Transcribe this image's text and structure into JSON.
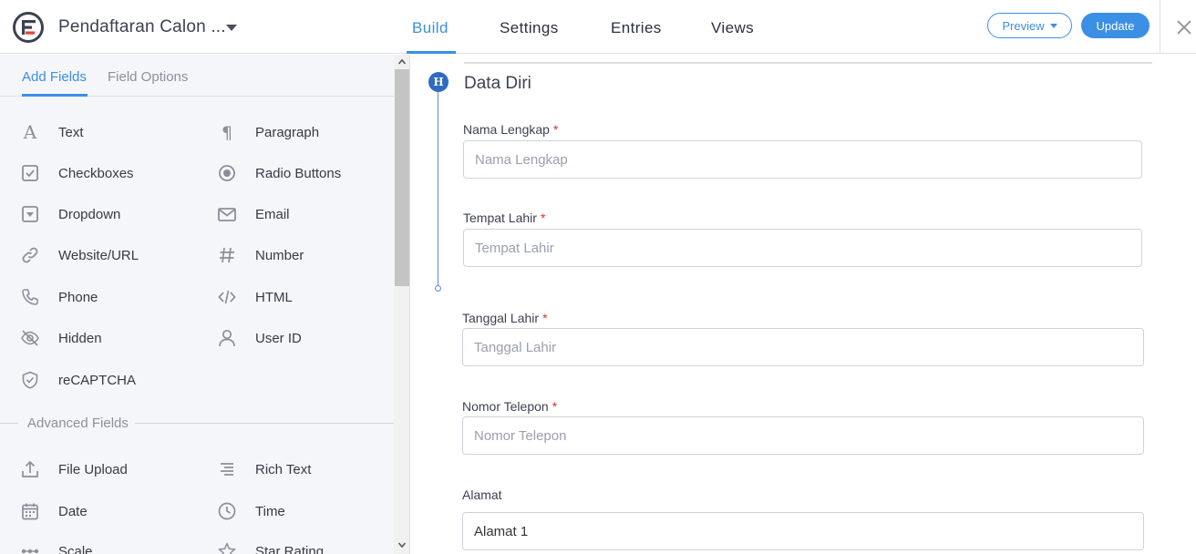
{
  "header": {
    "form_title": "Pendaftaran Calon ...",
    "nav_tabs": [
      "Build",
      "Settings",
      "Entries",
      "Views"
    ],
    "active_tab": "Build",
    "preview_label": "Preview",
    "update_label": "Update",
    "accent_color": "#3b8fe4"
  },
  "sidebar": {
    "tabs": [
      "Add Fields",
      "Field Options"
    ],
    "active_tab": "Add Fields",
    "fields": [
      {
        "label": "Text",
        "icon": "text-icon"
      },
      {
        "label": "Paragraph",
        "icon": "paragraph-icon"
      },
      {
        "label": "Checkboxes",
        "icon": "checkbox-icon"
      },
      {
        "label": "Radio Buttons",
        "icon": "radio-icon"
      },
      {
        "label": "Dropdown",
        "icon": "dropdown-icon"
      },
      {
        "label": "Email",
        "icon": "email-icon"
      },
      {
        "label": "Website/URL",
        "icon": "link-icon"
      },
      {
        "label": "Number",
        "icon": "hash-icon"
      },
      {
        "label": "Phone",
        "icon": "phone-icon"
      },
      {
        "label": "HTML",
        "icon": "code-icon"
      },
      {
        "label": "Hidden",
        "icon": "eye-off-icon"
      },
      {
        "label": "User ID",
        "icon": "user-icon"
      },
      {
        "label": "reCAPTCHA",
        "icon": "shield-icon"
      }
    ],
    "advanced_label": "Advanced Fields",
    "advanced_fields": [
      {
        "label": "File Upload",
        "icon": "upload-icon"
      },
      {
        "label": "Rich Text",
        "icon": "rich-text-icon"
      },
      {
        "label": "Date",
        "icon": "calendar-icon"
      },
      {
        "label": "Time",
        "icon": "clock-icon"
      },
      {
        "label": "Scale",
        "icon": "scale-icon"
      },
      {
        "label": "Star Rating",
        "icon": "star-icon"
      }
    ]
  },
  "canvas": {
    "section_badge": "H",
    "section_title": "Data Diri",
    "fields": [
      {
        "label": "Nama Lengkap",
        "required_mark": "*",
        "placeholder": "Nama Lengkap",
        "value": ""
      },
      {
        "label": "Tempat Lahir",
        "required_mark": "*",
        "placeholder": "Tempat Lahir",
        "value": ""
      },
      {
        "label": "Tanggal Lahir",
        "required_mark": "*",
        "placeholder": "Tanggal Lahir",
        "value": ""
      },
      {
        "label": "Nomor Telepon",
        "required_mark": "*",
        "placeholder": "Nomor Telepon",
        "value": ""
      },
      {
        "label": "Alamat",
        "required_mark": "",
        "placeholder": "",
        "value": "Alamat 1"
      }
    ]
  }
}
